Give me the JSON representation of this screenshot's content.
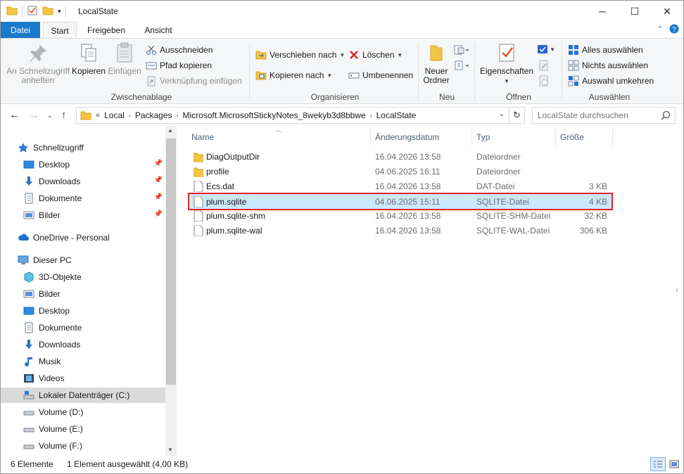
{
  "window": {
    "title": "LocalState",
    "minimize": "─",
    "maximize": "☐",
    "close": "✕"
  },
  "ribbon_tabs": [
    "Datei",
    "Start",
    "Freigeben",
    "Ansicht"
  ],
  "ribbon": {
    "clipboard": {
      "pin": "An Schnellzugriff anheften",
      "copy": "Kopieren",
      "paste": "Einfügen",
      "cut": "Ausschneiden",
      "copy_path": "Pfad kopieren",
      "paste_shortcut": "Verknüpfung einfügen",
      "label": "Zwischenablage"
    },
    "organize": {
      "move_to": "Verschieben nach",
      "copy_to": "Kopieren nach",
      "delete": "Löschen",
      "rename": "Umbenennen",
      "label": "Organisieren"
    },
    "new": {
      "new_folder": "Neuer Ordner",
      "label": "Neu"
    },
    "open": {
      "properties": "Eigenschaften",
      "label": "Öffnen"
    },
    "select": {
      "select_all": "Alles auswählen",
      "select_none": "Nichts auswählen",
      "invert": "Auswahl umkehren",
      "label": "Auswählen"
    }
  },
  "address": {
    "overflow": "«",
    "crumbs": [
      "Local",
      "Packages",
      "Microsoft.MicrosoftStickyNotes_8wekyb3d8bbwe",
      "LocalState"
    ],
    "search_placeholder": "LocalState durchsuchen"
  },
  "nav": {
    "quick_access": "Schnellzugriff",
    "quick_items": [
      "Desktop",
      "Downloads",
      "Dokumente",
      "Bilder"
    ],
    "onedrive": "OneDrive - Personal",
    "this_pc": "Dieser PC",
    "pc_items": [
      "3D-Objekte",
      "Bilder",
      "Desktop",
      "Dokumente",
      "Downloads",
      "Musik",
      "Videos",
      "Lokaler Datenträger (C:)",
      "Volume (D:)",
      "Volume (E:)",
      "Volume (F:)"
    ]
  },
  "columns": {
    "name": "Name",
    "date": "Änderungsdatum",
    "type": "Typ",
    "size": "Größe"
  },
  "files": [
    {
      "name": "DiagOutputDir",
      "date": "16.04.2026 13:58",
      "type": "Dateiordner",
      "size": "",
      "kind": "folder"
    },
    {
      "name": "profile",
      "date": "04.06.2025 16:11",
      "type": "Dateiordner",
      "size": "",
      "kind": "folder"
    },
    {
      "name": "Ecs.dat",
      "date": "16.04.2026 13:58",
      "type": "DAT-Datei",
      "size": "3 KB",
      "kind": "file"
    },
    {
      "name": "plum.sqlite",
      "date": "04.06.2025 15:11",
      "type": "SQLITE-Datei",
      "size": "4 KB",
      "kind": "file",
      "selected": true
    },
    {
      "name": "plum.sqlite-shm",
      "date": "16.04.2026 13:58",
      "type": "SQLITE-SHM-Datei",
      "size": "32 KB",
      "kind": "file"
    },
    {
      "name": "plum.sqlite-wal",
      "date": "16.04.2026 13:58",
      "type": "SQLITE-WAL-Datei",
      "size": "306 KB",
      "kind": "file"
    }
  ],
  "status": {
    "count": "6 Elemente",
    "selection": "1 Element ausgewählt (4,00 KB)"
  },
  "colors": {
    "accent": "#1979ca",
    "selection": "#cce8ff",
    "highlight_border": "#e02424",
    "folder": "#f4c542"
  }
}
